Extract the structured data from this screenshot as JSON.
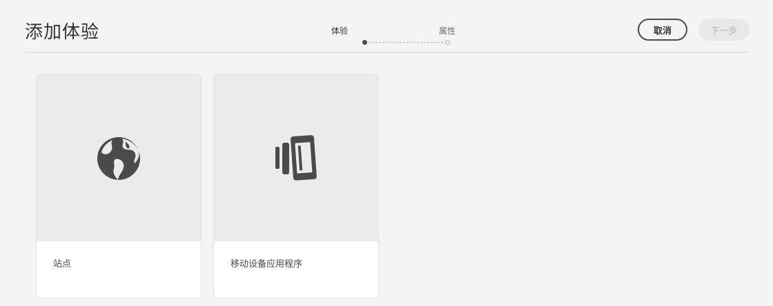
{
  "header": {
    "title": "添加体验",
    "cancel_label": "取消",
    "next_label": "下一步"
  },
  "wizard": {
    "steps": [
      {
        "label": "体验",
        "state": "active"
      },
      {
        "label": "属性",
        "state": "inactive"
      }
    ]
  },
  "cards": [
    {
      "label": "站点",
      "icon": "globe-icon"
    },
    {
      "label": "移动设备应用程序",
      "icon": "mobile-devices-icon"
    }
  ],
  "colors": {
    "background": "#f4f4f4",
    "card_thumb": "#ebebeb",
    "icon": "#4b4b4b",
    "text_dark": "#323232",
    "disabled_text": "#b3b3b3"
  }
}
